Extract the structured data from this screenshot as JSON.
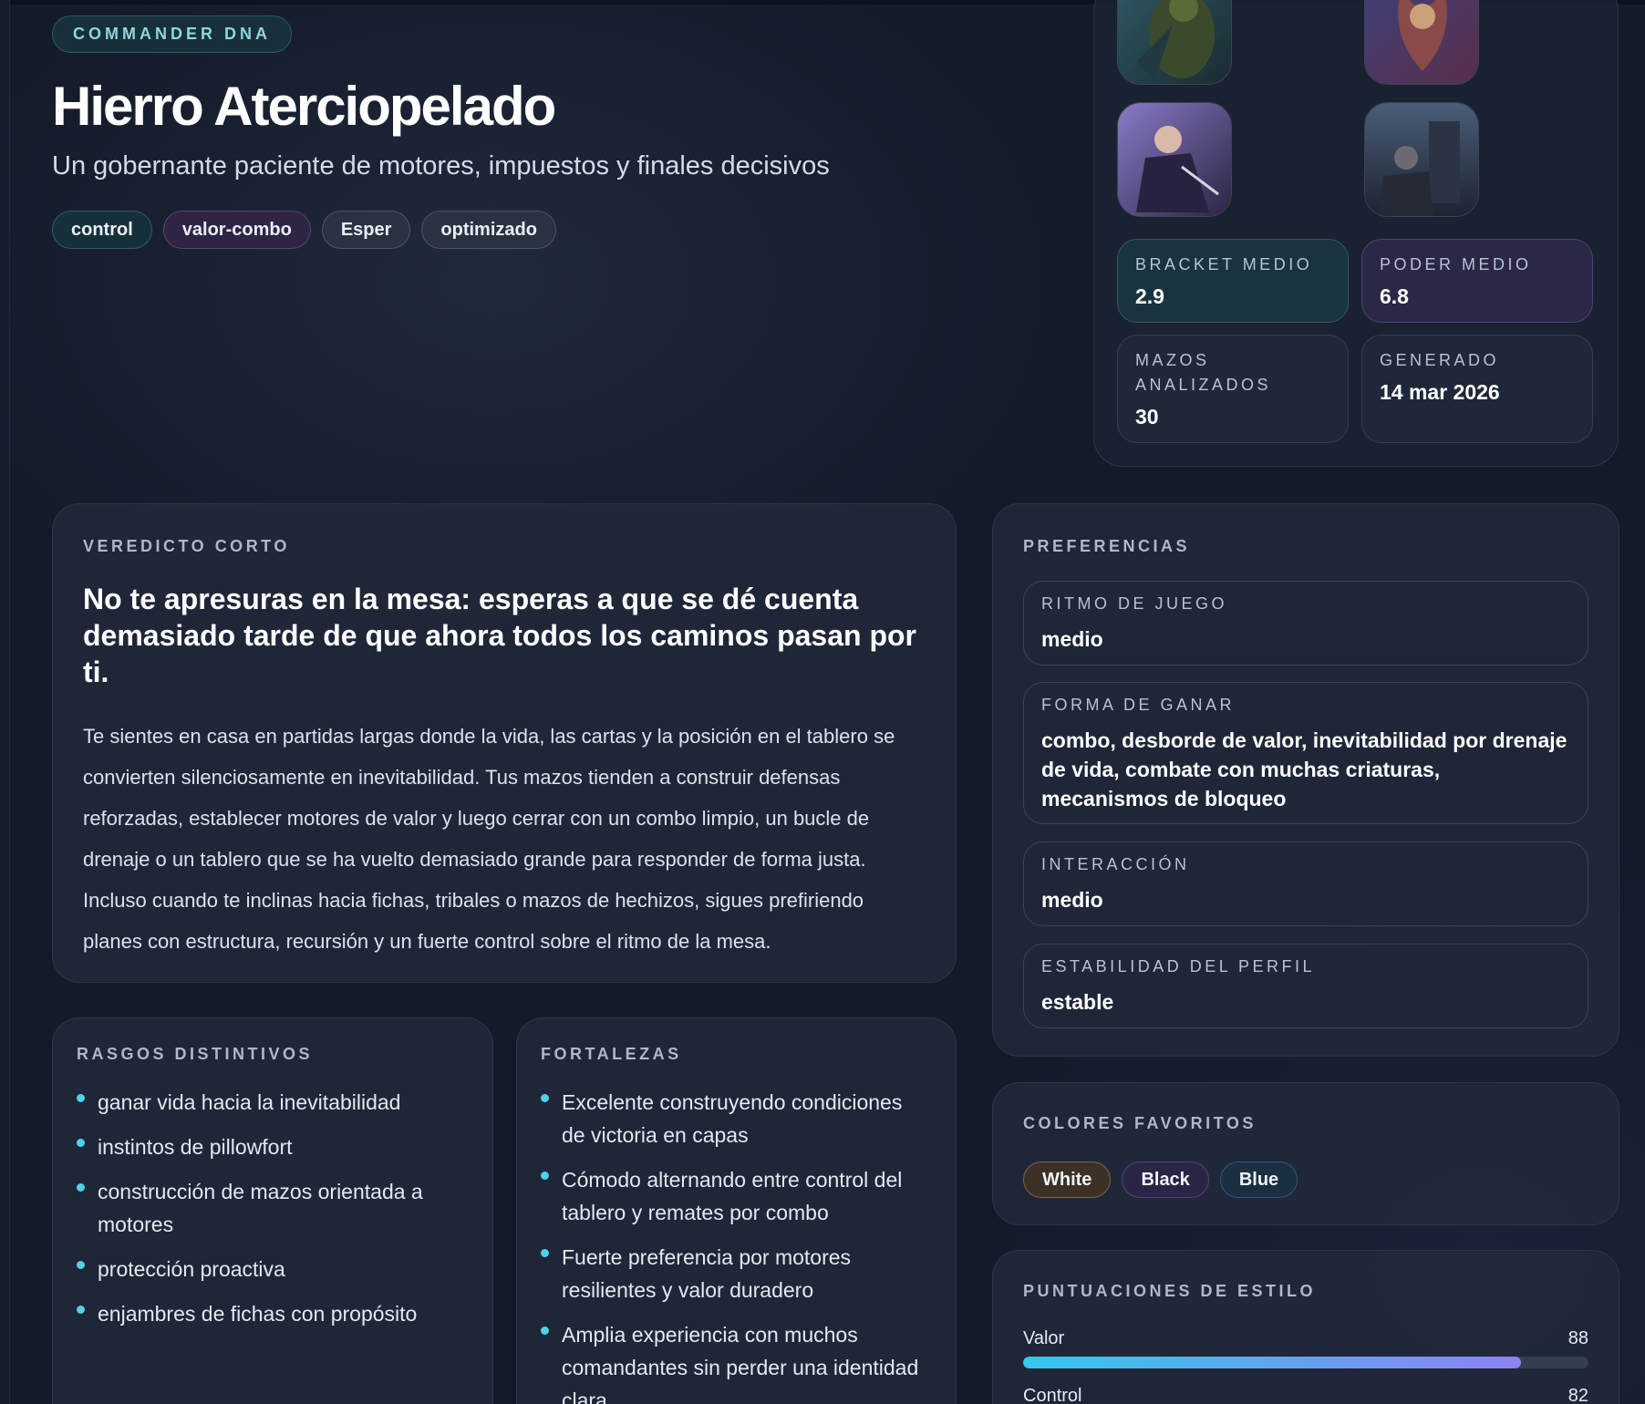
{
  "hero": {
    "eyebrow": "COMMANDER DNA",
    "title": "Hierro Aterciopelado",
    "subtitle": "Un gobernante paciente de motores, impuestos y finales decisivos",
    "tags": [
      "control",
      "valor-combo",
      "Esper",
      "optimizado"
    ]
  },
  "stats": [
    {
      "label": "BRACKET MEDIO",
      "value": "2.9"
    },
    {
      "label": "PODER MEDIO",
      "value": "6.8"
    },
    {
      "label": "MAZOS ANALIZADOS",
      "value": "30"
    },
    {
      "label": "GENERADO",
      "value": "14 mar 2026"
    }
  ],
  "verdict": {
    "label": "VEREDICTO CORTO",
    "headline": "No te apresuras en la mesa: esperas a que se dé cuenta demasiado tarde de que ahora todos los caminos pasan por ti.",
    "body": "Te sientes en casa en partidas largas donde la vida, las cartas y la posición en el tablero se convierten silenciosamente en inevitabilidad. Tus mazos tienden a construir defensas reforzadas, establecer motores de valor y luego cerrar con un combo limpio, un bucle de drenaje o un tablero que se ha vuelto demasiado grande para responder de forma justa. Incluso cuando te inclinas hacia fichas, tribales o mazos de hechizos, sigues prefiriendo planes con estructura, recursión y un fuerte control sobre el ritmo de la mesa."
  },
  "preferences": {
    "label": "PREFERENCIAS",
    "items": [
      {
        "label": "RITMO DE JUEGO",
        "value": "medio"
      },
      {
        "label": "FORMA DE GANAR",
        "value": "combo, desborde de valor, inevitabilidad por drenaje de vida, combate con muchas criaturas, mecanismos de bloqueo"
      },
      {
        "label": "INTERACCIÓN",
        "value": "medio"
      },
      {
        "label": "ESTABILIDAD DEL PERFIL",
        "value": "estable"
      }
    ]
  },
  "traits": {
    "label": "RASGOS DISTINTIVOS",
    "items": [
      "ganar vida hacia la inevitabilidad",
      "instintos de pillowfort",
      "construcción de mazos orientada a motores",
      "protección proactiva",
      "enjambres de fichas con propósito"
    ]
  },
  "strengths": {
    "label": "FORTALEZAS",
    "items": [
      "Excelente construyendo condiciones de victoria en capas",
      "Cómodo alternando entre control del tablero y remates por combo",
      "Fuerte preferencia por motores resilientes y valor duradero",
      "Amplia experiencia con muchos comandantes sin perder una identidad clara"
    ]
  },
  "colors": {
    "label": "COLORES FAVORITOS",
    "items": [
      "White",
      "Black",
      "Blue"
    ]
  },
  "scores": {
    "label": "PUNTUACIONES DE ESTILO",
    "items": [
      {
        "name": "Valor",
        "value": 88
      },
      {
        "name": "Control",
        "value": 82
      }
    ]
  }
}
